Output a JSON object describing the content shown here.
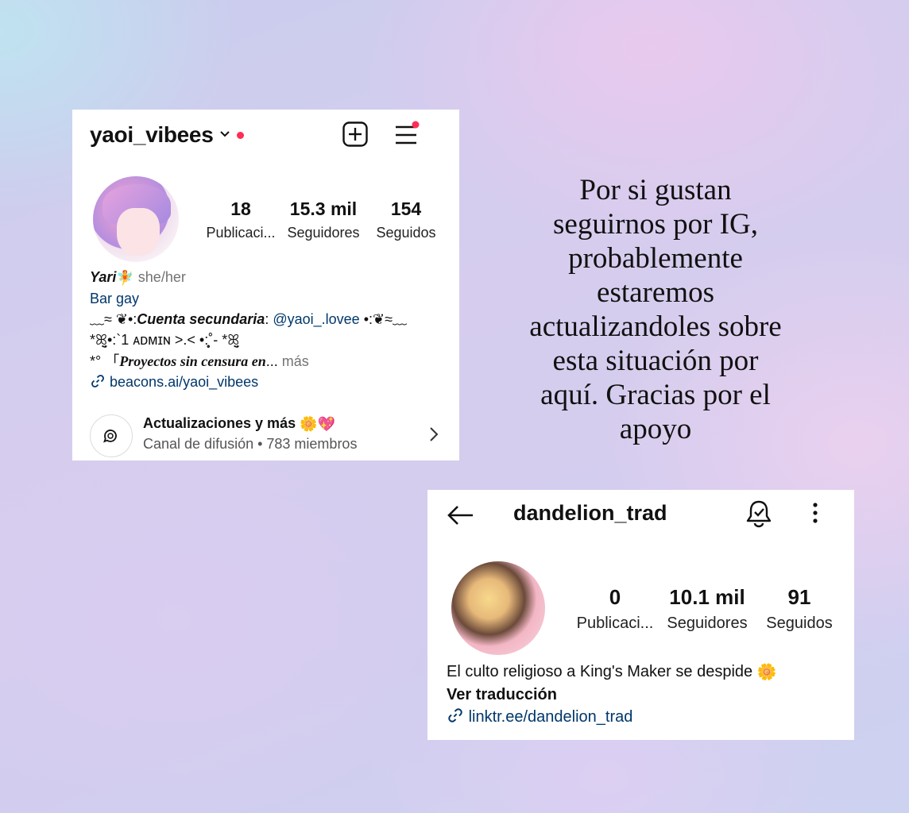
{
  "card1": {
    "username": "yaoi_vibees",
    "stats": [
      {
        "value": "18",
        "label": "Publicaci..."
      },
      {
        "value": "15.3 mil",
        "label": "Seguidores"
      },
      {
        "value": "154",
        "label": "Seguidos"
      }
    ],
    "bio": {
      "name": "Yari",
      "pronouns": "she/her",
      "category": "Bar gay",
      "line1_prefix": "﹏≈ ❦•:",
      "line1_bold": "Cuenta secundaria",
      "line1_colon": ": ",
      "line1_mention": "@yaoi_.lovee",
      "line1_suffix": " •:❦≈﹏",
      "line2": "*ꕤ̤̮•:`1 ᴀᴅᴍɪɴ >.< •:̥̩̥˚- *ꕤ̤̮",
      "line3_prefix": "*° 「",
      "line3_bold": "Proyectos sin censura en",
      "line3_ellipsis": "...",
      "line3_more": " más",
      "link": "beacons.ai/yaoi_vibees"
    },
    "channel": {
      "title": "Actualizaciones y más",
      "subtitle": "Canal de difusión • 783 miembros"
    }
  },
  "card2": {
    "username": "dandelion_trad",
    "stats": [
      {
        "value": "0",
        "label": "Publicaci..."
      },
      {
        "value": "10.1 mil",
        "label": "Seguidores"
      },
      {
        "value": "91",
        "label": "Seguidos"
      }
    ],
    "bio": {
      "text": "El culto religioso a King's Maker se despide",
      "translate": "Ver traducción",
      "link": "linktr.ee/dandelion_trad"
    }
  },
  "message": {
    "lines": [
      "Por si gustan",
      "seguirnos por IG,",
      "probablemente",
      "estaremos",
      "actualizandoles sobre",
      "esta situación por",
      "aquí. Gracias por el",
      "apoyo"
    ]
  },
  "icons": {
    "card1": [
      "chevron-down-icon",
      "notification-dot-icon",
      "new-post-icon",
      "menu-icon",
      "link-icon",
      "broadcast-channel-icon",
      "chevron-right-icon"
    ],
    "card2": [
      "back-arrow-icon",
      "bell-check-icon",
      "more-vertical-icon",
      "link-icon",
      "flower-emoji"
    ]
  },
  "colors": {
    "link": "#00376b",
    "notification": "#ff2d55",
    "muted": "#737373"
  }
}
